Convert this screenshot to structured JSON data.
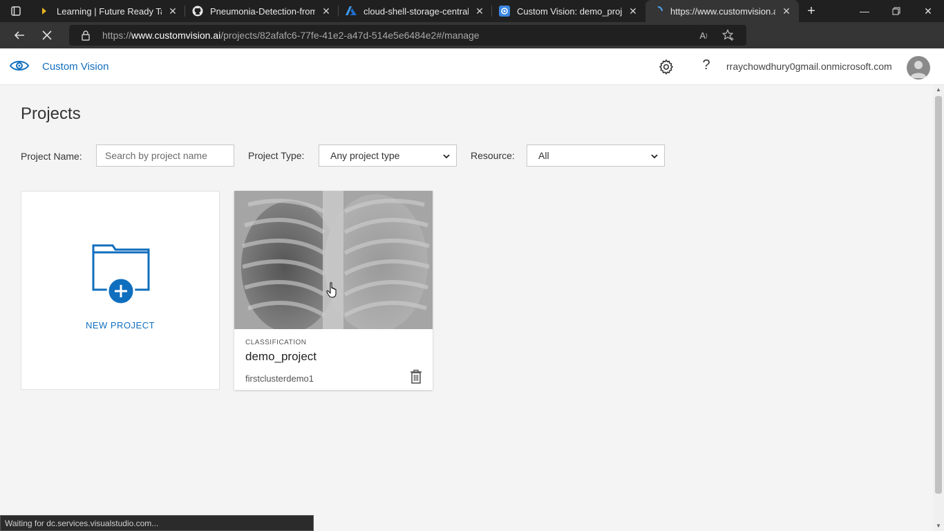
{
  "browser": {
    "tabs": [
      {
        "title": "Learning | Future Ready Talen",
        "icon": "learning-tab-icon"
      },
      {
        "title": "Pneumonia-Detection-from-C",
        "icon": "github-icon"
      },
      {
        "title": "cloud-shell-storage-centralin",
        "icon": "azure-icon"
      },
      {
        "title": "Custom Vision: demo_project",
        "icon": "custom-vision-tab-icon"
      },
      {
        "title": "https://www.customvision.ai/",
        "icon": "loading-tab-icon"
      }
    ],
    "url_prefix": "https://",
    "url_domain": "www.customvision.ai",
    "url_path": "/projects/82afafc6-77fe-41e2-a47d-514e5e6484e2#/manage",
    "status_text": "Waiting for dc.services.visualstudio.com..."
  },
  "app": {
    "brand": "Custom Vision",
    "user_email": "rraychowdhury0gmail.onmicrosoft.com",
    "accent_color": "#106ebe"
  },
  "page": {
    "title": "Projects",
    "filters": {
      "name_label": "Project Name:",
      "name_placeholder": "Search by project name",
      "type_label": "Project Type:",
      "type_value": "Any project type",
      "resource_label": "Resource:",
      "resource_value": "All"
    },
    "new_project_label": "NEW PROJECT",
    "projects": [
      {
        "type": "CLASSIFICATION",
        "name": "demo_project",
        "resource": "firstclusterdemo1"
      }
    ]
  }
}
